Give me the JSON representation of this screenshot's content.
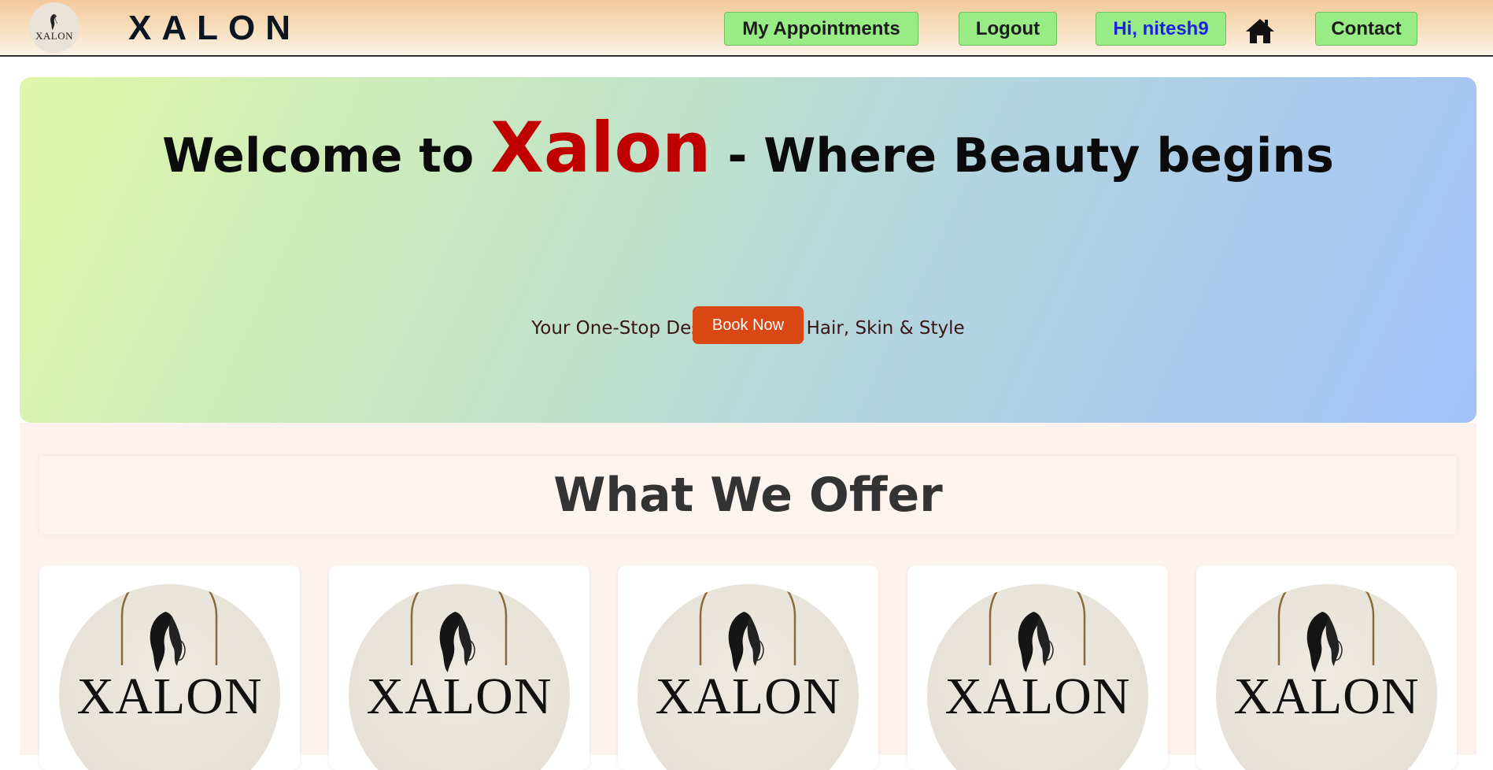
{
  "navbar": {
    "logo_text": "XALON",
    "brand": "XALON",
    "buttons": {
      "appointments": "My Appointments",
      "logout": "Logout",
      "user_greeting": "Hi, nitesh9",
      "contact": "Contact"
    },
    "home_icon": "home-icon"
  },
  "hero": {
    "title_prefix": "Welcome to ",
    "title_brand": "Xalon",
    "title_suffix": " - Where Beauty begins",
    "subtitle": "Your One-Stop Destination for Hair, Skin & Style",
    "cta_label": "Book Now"
  },
  "services": {
    "heading": "What We Offer",
    "cards": [
      {
        "logo_text": "XALON"
      },
      {
        "logo_text": "XALON"
      },
      {
        "logo_text": "XALON"
      },
      {
        "logo_text": "XALON"
      },
      {
        "logo_text": "XALON"
      }
    ]
  },
  "colors": {
    "nav_button_bg": "#99ec85",
    "user_text": "#1f21e0",
    "brand_red": "#c00000",
    "cta_bg": "#d94814",
    "offer_bg": "#fdf2ee"
  }
}
